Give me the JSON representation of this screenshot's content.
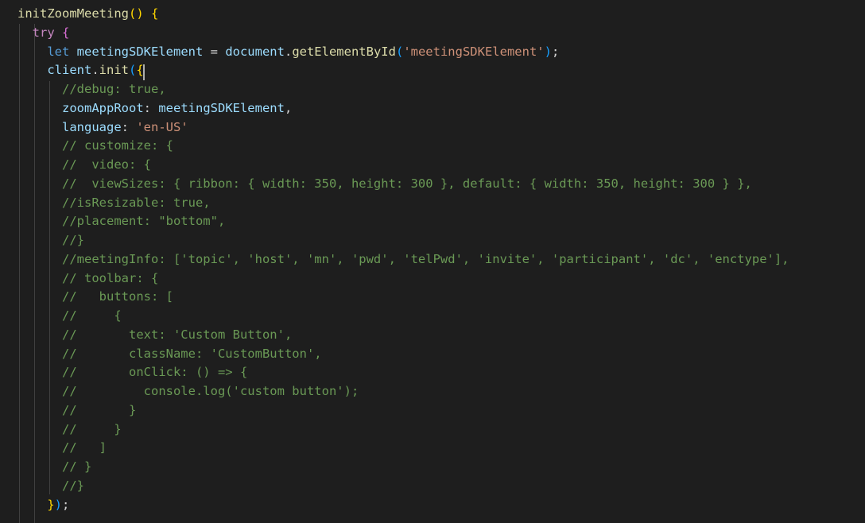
{
  "colors": {
    "background": "#1e1e1e",
    "function": "#dcdcaa",
    "keyword": "#c586c0",
    "storage": "#569cd6",
    "variable": "#9cdcfe",
    "string": "#ce9178",
    "comment": "#6a9955",
    "text": "#d4d4d4",
    "bracket_gold": "#ffd700",
    "bracket_purple": "#da70d6",
    "bracket_blue": "#179fff"
  },
  "editor": {
    "lines": [
      {
        "indent": "",
        "tokens": [
          {
            "t": "initZoomMeeting",
            "c": "function"
          },
          {
            "t": "() ",
            "c": "bracket_gold"
          },
          {
            "t": "{",
            "c": "bracket_gold"
          }
        ]
      },
      {
        "indent": "  ",
        "tokens": [
          {
            "t": "try",
            "c": "keyword"
          },
          {
            "t": " ",
            "c": "text"
          },
          {
            "t": "{",
            "c": "bracket_purple"
          }
        ]
      },
      {
        "indent": "    ",
        "tokens": [
          {
            "t": "let",
            "c": "storage"
          },
          {
            "t": " ",
            "c": "text"
          },
          {
            "t": "meetingSDKElement",
            "c": "variable"
          },
          {
            "t": " = ",
            "c": "text"
          },
          {
            "t": "document",
            "c": "variable"
          },
          {
            "t": ".",
            "c": "text"
          },
          {
            "t": "getElementById",
            "c": "function"
          },
          {
            "t": "(",
            "c": "bracket_blue"
          },
          {
            "t": "'meetingSDKElement'",
            "c": "string"
          },
          {
            "t": ")",
            "c": "bracket_blue"
          },
          {
            "t": ";",
            "c": "text"
          }
        ]
      },
      {
        "indent": "    ",
        "tokens": [
          {
            "t": "client",
            "c": "variable"
          },
          {
            "t": ".",
            "c": "text"
          },
          {
            "t": "init",
            "c": "function"
          },
          {
            "t": "(",
            "c": "bracket_blue"
          },
          {
            "t": "{",
            "c": "bracket_gold"
          }
        ]
      },
      {
        "indent": "      ",
        "tokens": [
          {
            "t": "//debug: true,",
            "c": "comment"
          }
        ]
      },
      {
        "indent": "      ",
        "tokens": [
          {
            "t": "zoomAppRoot",
            "c": "variable"
          },
          {
            "t": ": ",
            "c": "text"
          },
          {
            "t": "meetingSDKElement",
            "c": "variable"
          },
          {
            "t": ",",
            "c": "text"
          }
        ]
      },
      {
        "indent": "      ",
        "tokens": [
          {
            "t": "language",
            "c": "variable"
          },
          {
            "t": ": ",
            "c": "text"
          },
          {
            "t": "'en-US'",
            "c": "string"
          }
        ]
      },
      {
        "indent": "      ",
        "tokens": [
          {
            "t": "// customize: {",
            "c": "comment"
          }
        ]
      },
      {
        "indent": "      ",
        "tokens": [
          {
            "t": "//  video: {",
            "c": "comment"
          }
        ]
      },
      {
        "indent": "      ",
        "tokens": [
          {
            "t": "//  viewSizes: { ribbon: { width: 350, height: 300 }, default: { width: 350, height: 300 } },",
            "c": "comment"
          }
        ]
      },
      {
        "indent": "      ",
        "tokens": [
          {
            "t": "//isResizable: true,",
            "c": "comment"
          }
        ]
      },
      {
        "indent": "      ",
        "tokens": [
          {
            "t": "//placement: \"bottom\",",
            "c": "comment"
          }
        ]
      },
      {
        "indent": "      ",
        "tokens": [
          {
            "t": "//}",
            "c": "comment"
          }
        ]
      },
      {
        "indent": "      ",
        "tokens": [
          {
            "t": "//meetingInfo: ['topic', 'host', 'mn', 'pwd', 'telPwd', 'invite', 'participant', 'dc', 'enctype'],",
            "c": "comment"
          }
        ]
      },
      {
        "indent": "      ",
        "tokens": [
          {
            "t": "// toolbar: {",
            "c": "comment"
          }
        ]
      },
      {
        "indent": "      ",
        "tokens": [
          {
            "t": "//   buttons: [",
            "c": "comment"
          }
        ]
      },
      {
        "indent": "      ",
        "tokens": [
          {
            "t": "//     {",
            "c": "comment"
          }
        ]
      },
      {
        "indent": "      ",
        "tokens": [
          {
            "t": "//       text: 'Custom Button',",
            "c": "comment"
          }
        ]
      },
      {
        "indent": "      ",
        "tokens": [
          {
            "t": "//       className: 'CustomButton',",
            "c": "comment"
          }
        ]
      },
      {
        "indent": "      ",
        "tokens": [
          {
            "t": "//       onClick: () => {",
            "c": "comment"
          }
        ]
      },
      {
        "indent": "      ",
        "tokens": [
          {
            "t": "//         console.log('custom button');",
            "c": "comment"
          }
        ]
      },
      {
        "indent": "      ",
        "tokens": [
          {
            "t": "//       }",
            "c": "comment"
          }
        ]
      },
      {
        "indent": "      ",
        "tokens": [
          {
            "t": "//     }",
            "c": "comment"
          }
        ]
      },
      {
        "indent": "      ",
        "tokens": [
          {
            "t": "//   ]",
            "c": "comment"
          }
        ]
      },
      {
        "indent": "      ",
        "tokens": [
          {
            "t": "// }",
            "c": "comment"
          }
        ]
      },
      {
        "indent": "      ",
        "tokens": [
          {
            "t": "//}",
            "c": "comment"
          }
        ]
      },
      {
        "indent": "    ",
        "tokens": [
          {
            "t": "}",
            "c": "bracket_gold"
          },
          {
            "t": ")",
            "c": "bracket_blue"
          },
          {
            "t": ";",
            "c": "text"
          }
        ]
      }
    ]
  }
}
